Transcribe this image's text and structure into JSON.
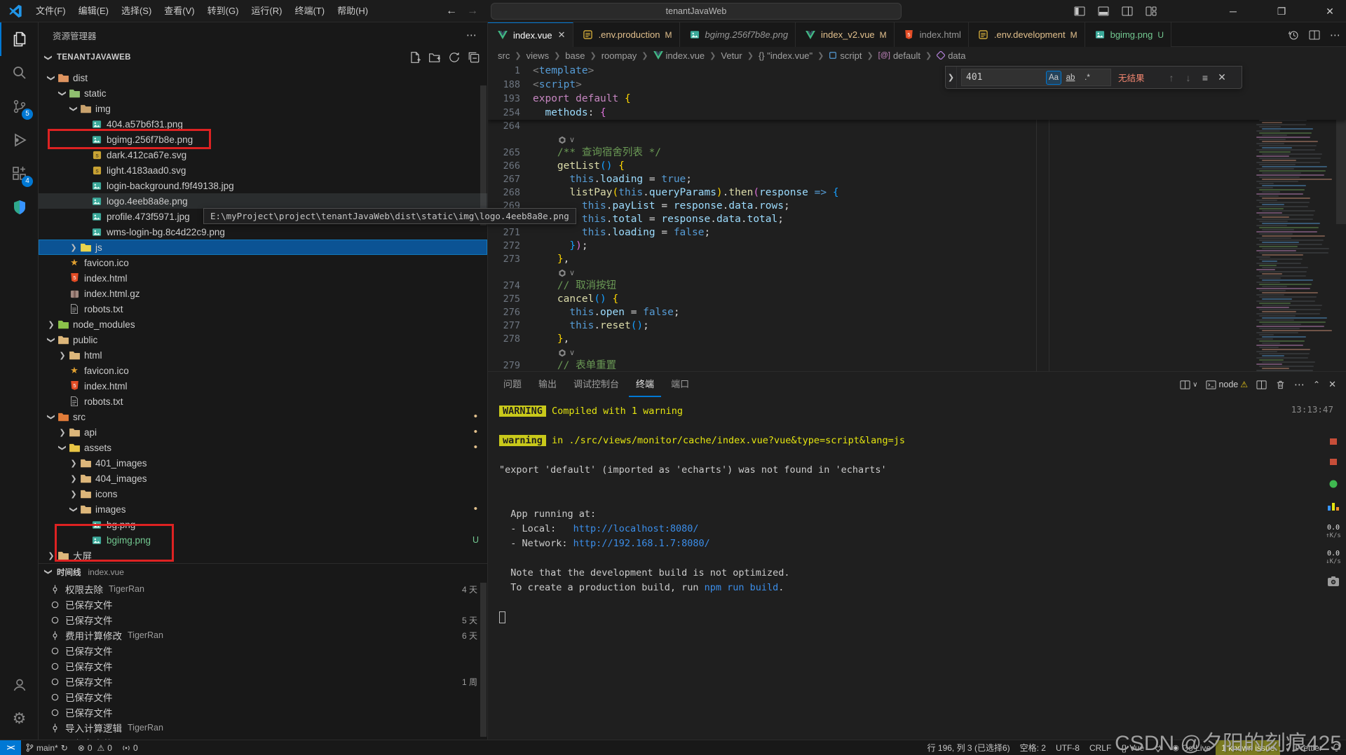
{
  "colors": {
    "accent": "#0078d4",
    "git_modified": "#e2c08d",
    "git_untracked": "#73c991",
    "error_red": "#f48771"
  },
  "title_bar": {
    "menus": [
      "文件(F)",
      "编辑(E)",
      "选择(S)",
      "查看(V)",
      "转到(G)",
      "运行(R)",
      "终端(T)",
      "帮助(H)"
    ],
    "back": "←",
    "forward": "→",
    "command_center": "tenantJavaWeb",
    "window": {
      "minimize": "─",
      "restore": "❐",
      "close": "✕"
    }
  },
  "activity_bar": {
    "items": [
      {
        "name": "explorer",
        "active": true
      },
      {
        "name": "search"
      },
      {
        "name": "source-control",
        "badge": "5"
      },
      {
        "name": "run-debug"
      },
      {
        "name": "extensions",
        "badge": "4"
      },
      {
        "name": "extension-shield"
      }
    ],
    "bottom": [
      {
        "name": "account"
      },
      {
        "name": "settings"
      }
    ]
  },
  "sidebar": {
    "title": "资源管理器",
    "more": "⋯",
    "section": "TENANTJAVAWEB",
    "tree": [
      {
        "label": "dist",
        "depth": 0,
        "type": "folder",
        "open": true,
        "color": "#de9460"
      },
      {
        "label": "static",
        "depth": 1,
        "type": "folder",
        "open": true,
        "color": "#8fbf6f"
      },
      {
        "label": "img",
        "depth": 2,
        "type": "folder",
        "open": true,
        "color": "#c9a26d"
      },
      {
        "label": "404.a57b6f31.png",
        "depth": 3,
        "type": "image"
      },
      {
        "label": "bgimg.256f7b8e.png",
        "depth": 3,
        "type": "image",
        "boxed": true
      },
      {
        "label": "dark.412ca67e.svg",
        "depth": 3,
        "type": "svgfile"
      },
      {
        "label": "light.4183aad0.svg",
        "depth": 3,
        "type": "svgfile"
      },
      {
        "label": "login-background.f9f49138.jpg",
        "depth": 3,
        "type": "image"
      },
      {
        "label": "logo.4eeb8a8e.png",
        "depth": 3,
        "type": "image",
        "hovered": true
      },
      {
        "label": "profile.473f5971.jpg",
        "depth": 3,
        "type": "image"
      },
      {
        "label": "wms-login-bg.8c4d22c9.png",
        "depth": 3,
        "type": "image"
      },
      {
        "label": "js",
        "depth": 2,
        "type": "folder",
        "open": false,
        "selected": true,
        "color": "#e8d44d"
      },
      {
        "label": "favicon.ico",
        "depth": 1,
        "type": "ico"
      },
      {
        "label": "index.html",
        "depth": 1,
        "type": "html"
      },
      {
        "label": "index.html.gz",
        "depth": 1,
        "type": "gz"
      },
      {
        "label": "robots.txt",
        "depth": 1,
        "type": "txt"
      },
      {
        "label": "node_modules",
        "depth": 0,
        "type": "folder",
        "open": false,
        "color": "#8bc34a"
      },
      {
        "label": "public",
        "depth": 0,
        "type": "folder",
        "open": true,
        "color": "#dcb67a"
      },
      {
        "label": "html",
        "depth": 1,
        "type": "folder",
        "open": false,
        "color": "#dcb67a"
      },
      {
        "label": "favicon.ico",
        "depth": 1,
        "type": "ico"
      },
      {
        "label": "index.html",
        "depth": 1,
        "type": "html"
      },
      {
        "label": "robots.txt",
        "depth": 1,
        "type": "txt"
      },
      {
        "label": "src",
        "depth": 0,
        "type": "folder",
        "open": true,
        "color": "#e07b39",
        "dot": true
      },
      {
        "label": "api",
        "depth": 1,
        "type": "folder",
        "open": false,
        "color": "#dcb67a",
        "dot": true
      },
      {
        "label": "assets",
        "depth": 1,
        "type": "folder",
        "open": true,
        "color": "#e8c545",
        "dot": true
      },
      {
        "label": "401_images",
        "depth": 2,
        "type": "folder",
        "open": false,
        "color": "#dcb67a"
      },
      {
        "label": "404_images",
        "depth": 2,
        "type": "folder",
        "open": false,
        "color": "#dcb67a"
      },
      {
        "label": "icons",
        "depth": 2,
        "type": "folder",
        "open": false,
        "color": "#dcb67a"
      },
      {
        "label": "images",
        "depth": 2,
        "type": "folder",
        "open": true,
        "color": "#dcb67a",
        "dot": true
      },
      {
        "label": "bg.png",
        "depth": 3,
        "type": "image",
        "boxed2": true
      },
      {
        "label": "bgimg.png",
        "depth": 3,
        "type": "image",
        "git": "U",
        "boxed2": true
      },
      {
        "label": "大屏",
        "depth": 0,
        "type": "folder",
        "open": false,
        "color": "#dcb67a"
      }
    ],
    "tooltip": "E:\\myProject\\project\\tenantJavaWeb\\dist\\static\\img\\logo.4eeb8a8e.png",
    "timeline": {
      "title": "时间线",
      "file": "index.vue",
      "items": [
        {
          "label": "权限去除",
          "author": "TigerRan",
          "time": "4 天",
          "kind": "commit"
        },
        {
          "label": "已保存文件",
          "kind": "save"
        },
        {
          "label": "已保存文件",
          "time": "5 天",
          "kind": "save"
        },
        {
          "label": "费用计算修改",
          "author": "TigerRan",
          "time": "6 天",
          "kind": "commit"
        },
        {
          "label": "已保存文件",
          "kind": "save"
        },
        {
          "label": "已保存文件",
          "kind": "save"
        },
        {
          "label": "已保存文件",
          "time": "1 周",
          "kind": "save"
        },
        {
          "label": "已保存文件",
          "kind": "save"
        },
        {
          "label": "已保存文件",
          "kind": "save"
        },
        {
          "label": "导入计算逻辑",
          "author": "TigerRan",
          "kind": "commit"
        },
        {
          "label": "已保存文件",
          "kind": "save"
        }
      ]
    }
  },
  "tabs": [
    {
      "label": "index.vue",
      "icon": "vue",
      "active": true,
      "close": "✕"
    },
    {
      "label": ".env.production",
      "icon": "env",
      "git": "M",
      "color": "#e2c08d"
    },
    {
      "label": "bgimg.256f7b8e.png",
      "icon": "image",
      "italic": true
    },
    {
      "label": "index_v2.vue",
      "icon": "vue",
      "git": "M",
      "color": "#e2c08d"
    },
    {
      "label": "index.html",
      "icon": "html"
    },
    {
      "label": ".env.development",
      "icon": "env",
      "git": "M",
      "color": "#e2c08d"
    },
    {
      "label": "bgimg.png",
      "icon": "image",
      "git": "U",
      "color": "#73c991"
    }
  ],
  "breadcrumb": [
    {
      "label": "src"
    },
    {
      "label": "views"
    },
    {
      "label": "base"
    },
    {
      "label": "roompay"
    },
    {
      "label": "index.vue",
      "icon": "vue"
    },
    {
      "label": "Vetur"
    },
    {
      "label": "{} \"index.vue\""
    },
    {
      "label": "script",
      "icon": "sym-blue"
    },
    {
      "label": "default",
      "icon": "sym-at"
    },
    {
      "label": "data",
      "icon": "sym-purple"
    }
  ],
  "editor": {
    "sticky": [
      {
        "n": "1",
        "seg": [
          [
            "d",
            "<"
          ],
          [
            "k",
            "template"
          ],
          [
            "d",
            ">"
          ]
        ]
      },
      {
        "n": "188",
        "seg": [
          [
            "d",
            "<"
          ],
          [
            "k",
            "script"
          ],
          [
            "d",
            ">"
          ]
        ]
      },
      {
        "n": "193",
        "seg": [
          [
            "m",
            "export"
          ],
          [
            "w",
            " "
          ],
          [
            "m",
            "default"
          ],
          [
            "w",
            " "
          ],
          [
            "g",
            "{"
          ]
        ]
      },
      {
        "n": "254",
        "seg": [
          [
            "w",
            "  "
          ],
          [
            "p",
            "methods"
          ],
          [
            "w",
            ": "
          ],
          [
            "v",
            "{"
          ]
        ]
      }
    ],
    "lines": [
      {
        "n": "264",
        "seg": []
      },
      {
        "lens": true
      },
      {
        "n": "265",
        "seg": [
          [
            "w",
            "    "
          ],
          [
            "c",
            "/** 查询宿舍列表 */"
          ]
        ]
      },
      {
        "n": "266",
        "seg": [
          [
            "w",
            "    "
          ],
          [
            "f",
            "getList"
          ],
          [
            "b",
            "()"
          ],
          [
            "w",
            " "
          ],
          [
            "g",
            "{"
          ]
        ]
      },
      {
        "n": "267",
        "seg": [
          [
            "w",
            "      "
          ],
          [
            "k",
            "this"
          ],
          [
            "w",
            "."
          ],
          [
            "p",
            "loading"
          ],
          [
            "w",
            " = "
          ],
          [
            "k",
            "true"
          ],
          [
            "w",
            ";"
          ]
        ]
      },
      {
        "n": "268",
        "seg": [
          [
            "w",
            "      "
          ],
          [
            "f",
            "listPay"
          ],
          [
            "g",
            "("
          ],
          [
            "k",
            "this"
          ],
          [
            "w",
            "."
          ],
          [
            "p",
            "queryParams"
          ],
          [
            "g",
            ")"
          ],
          [
            "w",
            "."
          ],
          [
            "f",
            "then"
          ],
          [
            "v",
            "("
          ],
          [
            "p",
            "response"
          ],
          [
            "w",
            " "
          ],
          [
            "k",
            "=>"
          ],
          [
            "w",
            " "
          ],
          [
            "b",
            "{"
          ]
        ]
      },
      {
        "n": "269",
        "seg": [
          [
            "w",
            "        "
          ],
          [
            "k",
            "this"
          ],
          [
            "w",
            "."
          ],
          [
            "p",
            "payList"
          ],
          [
            "w",
            " = "
          ],
          [
            "p",
            "response"
          ],
          [
            "w",
            "."
          ],
          [
            "p",
            "data"
          ],
          [
            "w",
            "."
          ],
          [
            "p",
            "rows"
          ],
          [
            "w",
            ";"
          ]
        ]
      },
      {
        "n": "270",
        "seg": [
          [
            "w",
            "        "
          ],
          [
            "k",
            "this"
          ],
          [
            "w",
            "."
          ],
          [
            "p",
            "total"
          ],
          [
            "w",
            " = "
          ],
          [
            "p",
            "response"
          ],
          [
            "w",
            "."
          ],
          [
            "p",
            "data"
          ],
          [
            "w",
            "."
          ],
          [
            "p",
            "total"
          ],
          [
            "w",
            ";"
          ]
        ]
      },
      {
        "n": "271",
        "seg": [
          [
            "w",
            "        "
          ],
          [
            "k",
            "this"
          ],
          [
            "w",
            "."
          ],
          [
            "p",
            "loading"
          ],
          [
            "w",
            " = "
          ],
          [
            "k",
            "false"
          ],
          [
            "w",
            ";"
          ]
        ]
      },
      {
        "n": "272",
        "seg": [
          [
            "w",
            "      "
          ],
          [
            "b",
            "}"
          ],
          [
            "v",
            ")"
          ],
          [
            "w",
            ";"
          ]
        ]
      },
      {
        "n": "273",
        "seg": [
          [
            "w",
            "    "
          ],
          [
            "g",
            "}"
          ],
          [
            "w",
            ","
          ]
        ]
      },
      {
        "lens": true
      },
      {
        "n": "274",
        "seg": [
          [
            "w",
            "    "
          ],
          [
            "c",
            "// 取消按钮"
          ]
        ]
      },
      {
        "n": "275",
        "seg": [
          [
            "w",
            "    "
          ],
          [
            "f",
            "cancel"
          ],
          [
            "b",
            "()"
          ],
          [
            "w",
            " "
          ],
          [
            "g",
            "{"
          ]
        ]
      },
      {
        "n": "276",
        "seg": [
          [
            "w",
            "      "
          ],
          [
            "k",
            "this"
          ],
          [
            "w",
            "."
          ],
          [
            "p",
            "open"
          ],
          [
            "w",
            " = "
          ],
          [
            "k",
            "false"
          ],
          [
            "w",
            ";"
          ]
        ]
      },
      {
        "n": "277",
        "seg": [
          [
            "w",
            "      "
          ],
          [
            "k",
            "this"
          ],
          [
            "w",
            "."
          ],
          [
            "f",
            "reset"
          ],
          [
            "b",
            "()"
          ],
          [
            "w",
            ";"
          ]
        ]
      },
      {
        "n": "278",
        "seg": [
          [
            "w",
            "    "
          ],
          [
            "g",
            "}"
          ],
          [
            "w",
            ","
          ]
        ]
      },
      {
        "lens": true
      },
      {
        "n": "279",
        "seg": [
          [
            "w",
            "    "
          ],
          [
            "c",
            "// 表单重置"
          ]
        ]
      }
    ],
    "find": {
      "query": "401",
      "case": "Aa",
      "word": "ab",
      "regex": ".*",
      "result": "无结果",
      "prev": "↑",
      "next": "↓",
      "selection": "≡",
      "close": "✕",
      "toggle": "❯"
    }
  },
  "panel": {
    "tabs": [
      "问题",
      "输出",
      "调试控制台",
      "终端",
      "端口"
    ],
    "active_tab": "终端",
    "terminal_name": "node",
    "timestamp": "13:13:47",
    "lines": [
      {
        "badge": "WARNING",
        "rest": " Compiled with 1 warning",
        "color": "yellow",
        "time": true
      },
      {},
      {
        "badge": "warning",
        "rest": " in ./src/views/monitor/cache/index.vue?vue&type=script&lang=js",
        "color": "yellow"
      },
      {},
      {
        "text": "\"export 'default' (imported as 'echarts') was not found in 'echarts'"
      },
      {},
      {},
      {
        "text": "  App running at:"
      },
      {
        "parts": [
          [
            "w",
            "  - Local:   "
          ],
          [
            "link",
            "http://localhost:8080/"
          ]
        ]
      },
      {
        "parts": [
          [
            "w",
            "  - Network: "
          ],
          [
            "link",
            "http://192.168.1.7:8080/"
          ]
        ]
      },
      {},
      {
        "text": "  Note that the development build is not optimized."
      },
      {
        "parts": [
          [
            "w",
            "  To create a production build, run "
          ],
          [
            "link",
            "npm run build"
          ],
          [
            "w",
            "."
          ]
        ]
      },
      {},
      {
        "cursor": true
      }
    ],
    "rail": {
      "up": "0.0",
      "up_unit": "K/s",
      "down": "0.0",
      "down_unit": "K/s"
    }
  },
  "status_bar": {
    "remote": "><",
    "branch": "main*",
    "sync": "↻",
    "errors": "0",
    "warnings": "0",
    "ports": "0",
    "right": {
      "cursor": "行 196, 列 3 (已选择6)",
      "indent": "空格: 2",
      "encoding": "UTF-8",
      "eol": "CRLF",
      "language": "Vue",
      "lang_braces": "{}",
      "go_live": "Go Live",
      "known_issue": "1 known issue",
      "prettier": "Prettier",
      "prettier_check": "✓"
    }
  },
  "watermark": "CSDN @夕阳的刻痕425"
}
